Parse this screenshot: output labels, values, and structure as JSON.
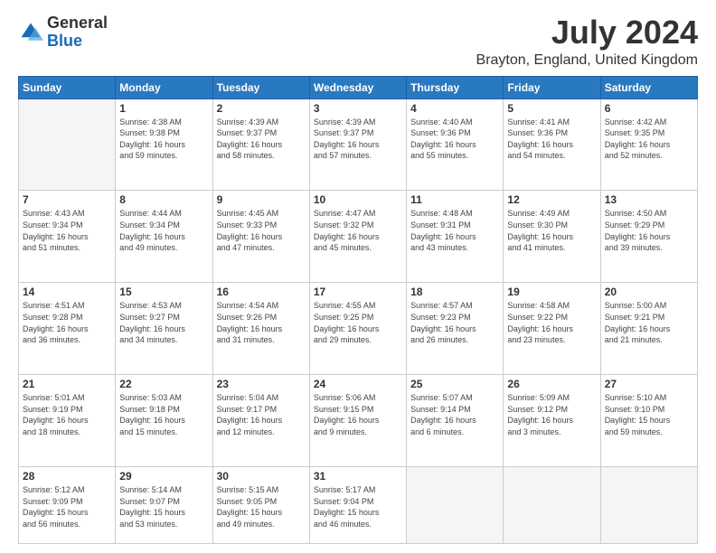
{
  "header": {
    "logo_line1": "General",
    "logo_line2": "Blue",
    "month_year": "July 2024",
    "location": "Brayton, England, United Kingdom"
  },
  "days_of_week": [
    "Sunday",
    "Monday",
    "Tuesday",
    "Wednesday",
    "Thursday",
    "Friday",
    "Saturday"
  ],
  "weeks": [
    [
      {
        "day": "",
        "info": ""
      },
      {
        "day": "1",
        "info": "Sunrise: 4:38 AM\nSunset: 9:38 PM\nDaylight: 16 hours\nand 59 minutes."
      },
      {
        "day": "2",
        "info": "Sunrise: 4:39 AM\nSunset: 9:37 PM\nDaylight: 16 hours\nand 58 minutes."
      },
      {
        "day": "3",
        "info": "Sunrise: 4:39 AM\nSunset: 9:37 PM\nDaylight: 16 hours\nand 57 minutes."
      },
      {
        "day": "4",
        "info": "Sunrise: 4:40 AM\nSunset: 9:36 PM\nDaylight: 16 hours\nand 55 minutes."
      },
      {
        "day": "5",
        "info": "Sunrise: 4:41 AM\nSunset: 9:36 PM\nDaylight: 16 hours\nand 54 minutes."
      },
      {
        "day": "6",
        "info": "Sunrise: 4:42 AM\nSunset: 9:35 PM\nDaylight: 16 hours\nand 52 minutes."
      }
    ],
    [
      {
        "day": "7",
        "info": "Sunrise: 4:43 AM\nSunset: 9:34 PM\nDaylight: 16 hours\nand 51 minutes."
      },
      {
        "day": "8",
        "info": "Sunrise: 4:44 AM\nSunset: 9:34 PM\nDaylight: 16 hours\nand 49 minutes."
      },
      {
        "day": "9",
        "info": "Sunrise: 4:45 AM\nSunset: 9:33 PM\nDaylight: 16 hours\nand 47 minutes."
      },
      {
        "day": "10",
        "info": "Sunrise: 4:47 AM\nSunset: 9:32 PM\nDaylight: 16 hours\nand 45 minutes."
      },
      {
        "day": "11",
        "info": "Sunrise: 4:48 AM\nSunset: 9:31 PM\nDaylight: 16 hours\nand 43 minutes."
      },
      {
        "day": "12",
        "info": "Sunrise: 4:49 AM\nSunset: 9:30 PM\nDaylight: 16 hours\nand 41 minutes."
      },
      {
        "day": "13",
        "info": "Sunrise: 4:50 AM\nSunset: 9:29 PM\nDaylight: 16 hours\nand 39 minutes."
      }
    ],
    [
      {
        "day": "14",
        "info": "Sunrise: 4:51 AM\nSunset: 9:28 PM\nDaylight: 16 hours\nand 36 minutes."
      },
      {
        "day": "15",
        "info": "Sunrise: 4:53 AM\nSunset: 9:27 PM\nDaylight: 16 hours\nand 34 minutes."
      },
      {
        "day": "16",
        "info": "Sunrise: 4:54 AM\nSunset: 9:26 PM\nDaylight: 16 hours\nand 31 minutes."
      },
      {
        "day": "17",
        "info": "Sunrise: 4:55 AM\nSunset: 9:25 PM\nDaylight: 16 hours\nand 29 minutes."
      },
      {
        "day": "18",
        "info": "Sunrise: 4:57 AM\nSunset: 9:23 PM\nDaylight: 16 hours\nand 26 minutes."
      },
      {
        "day": "19",
        "info": "Sunrise: 4:58 AM\nSunset: 9:22 PM\nDaylight: 16 hours\nand 23 minutes."
      },
      {
        "day": "20",
        "info": "Sunrise: 5:00 AM\nSunset: 9:21 PM\nDaylight: 16 hours\nand 21 minutes."
      }
    ],
    [
      {
        "day": "21",
        "info": "Sunrise: 5:01 AM\nSunset: 9:19 PM\nDaylight: 16 hours\nand 18 minutes."
      },
      {
        "day": "22",
        "info": "Sunrise: 5:03 AM\nSunset: 9:18 PM\nDaylight: 16 hours\nand 15 minutes."
      },
      {
        "day": "23",
        "info": "Sunrise: 5:04 AM\nSunset: 9:17 PM\nDaylight: 16 hours\nand 12 minutes."
      },
      {
        "day": "24",
        "info": "Sunrise: 5:06 AM\nSunset: 9:15 PM\nDaylight: 16 hours\nand 9 minutes."
      },
      {
        "day": "25",
        "info": "Sunrise: 5:07 AM\nSunset: 9:14 PM\nDaylight: 16 hours\nand 6 minutes."
      },
      {
        "day": "26",
        "info": "Sunrise: 5:09 AM\nSunset: 9:12 PM\nDaylight: 16 hours\nand 3 minutes."
      },
      {
        "day": "27",
        "info": "Sunrise: 5:10 AM\nSunset: 9:10 PM\nDaylight: 15 hours\nand 59 minutes."
      }
    ],
    [
      {
        "day": "28",
        "info": "Sunrise: 5:12 AM\nSunset: 9:09 PM\nDaylight: 15 hours\nand 56 minutes."
      },
      {
        "day": "29",
        "info": "Sunrise: 5:14 AM\nSunset: 9:07 PM\nDaylight: 15 hours\nand 53 minutes."
      },
      {
        "day": "30",
        "info": "Sunrise: 5:15 AM\nSunset: 9:05 PM\nDaylight: 15 hours\nand 49 minutes."
      },
      {
        "day": "31",
        "info": "Sunrise: 5:17 AM\nSunset: 9:04 PM\nDaylight: 15 hours\nand 46 minutes."
      },
      {
        "day": "",
        "info": ""
      },
      {
        "day": "",
        "info": ""
      },
      {
        "day": "",
        "info": ""
      }
    ]
  ]
}
